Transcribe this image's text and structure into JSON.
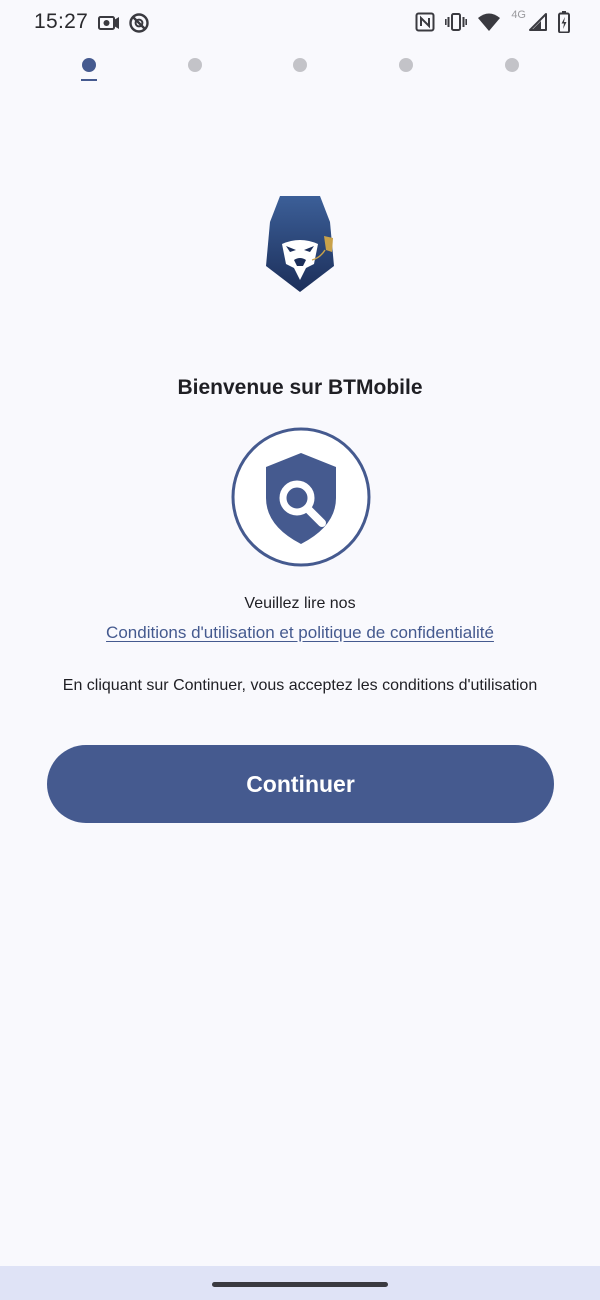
{
  "status_bar": {
    "time": "15:27",
    "network_type": "4G",
    "icons": [
      "photo-notification-icon",
      "do-not-disturb-icon",
      "nfc-icon",
      "vibrate-icon",
      "wifi-icon",
      "signal-icon",
      "battery-charging-icon"
    ]
  },
  "pager": {
    "total": 5,
    "active_index": 0
  },
  "brand": {
    "logo_icon": "gorilla-shield-logo-icon",
    "primary_color": "#455a8f"
  },
  "welcome": {
    "title": "Bienvenue sur BTMobile"
  },
  "privacy_badge": {
    "icon": "shield-search-icon"
  },
  "terms": {
    "read_prompt": "Veuillez lire nos",
    "link_label": "Conditions d'utilisation et politique de confidentialité",
    "accept_notice": "En cliquant sur Continuer, vous acceptez les conditions d'utilisation"
  },
  "actions": {
    "continue_label": "Continuer"
  }
}
